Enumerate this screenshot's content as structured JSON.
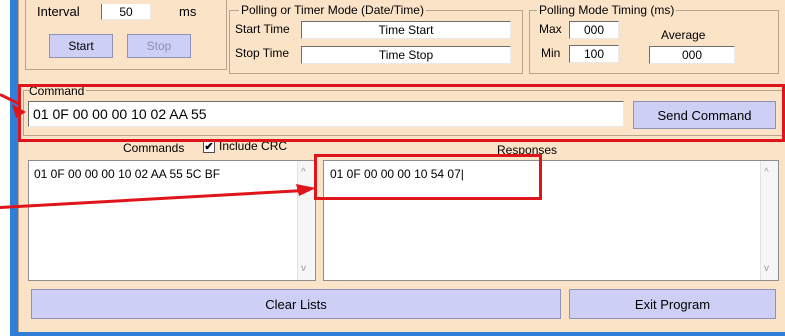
{
  "top": {
    "interval_label": "Interval",
    "interval_value": "50",
    "interval_unit": "ms",
    "start_button": "Start",
    "stop_button": "Stop"
  },
  "polling": {
    "group_label": "Polling  or Timer Mode  (Date/Time)",
    "start_label": "Start Time",
    "start_value": "Time Start",
    "stop_label": "Stop Time",
    "stop_value": "Time Stop"
  },
  "timing": {
    "group_label": "Polling Mode Timing (ms)",
    "max_label": "Max",
    "max_value": "000",
    "min_label": "Min",
    "min_value": "100",
    "average_label": "Average",
    "average_value": "000"
  },
  "command": {
    "label": "Command",
    "value": "01 0F 00 00 00 10 02 AA 55",
    "send_button": "Send Command"
  },
  "lists": {
    "commands_label": "Commands",
    "include_crc_label": "Include CRC",
    "include_crc_checked": true,
    "responses_label": "Responses",
    "commands_items": [
      "01 0F 00 00 00 10 02 AA 55 5C BF"
    ],
    "responses_items": [
      "01 0F 00 00 00 10 54 07"
    ]
  },
  "bottom": {
    "clear_button": "Clear Lists",
    "exit_button": "Exit Program"
  },
  "colors": {
    "panel": "#fbe3c8",
    "button": "#cdcff4",
    "highlight": "#e0151b",
    "frame": "#2f7fd8"
  }
}
